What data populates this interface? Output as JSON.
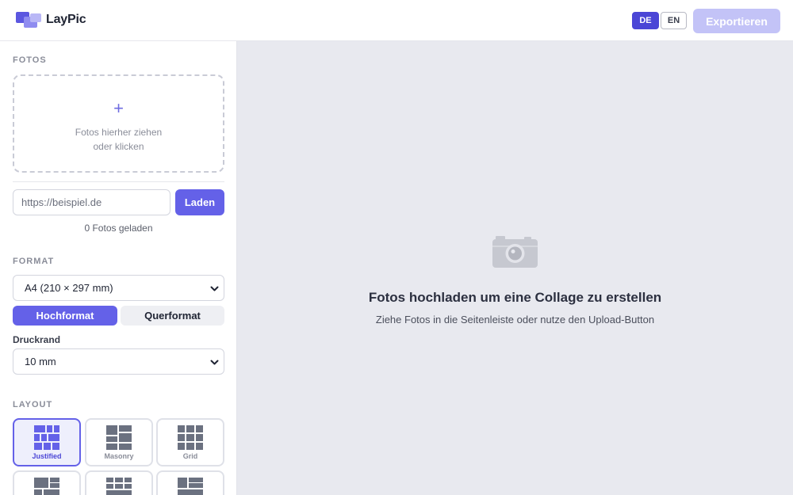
{
  "app": {
    "name": "LayPic",
    "brand_color": "#6461e8"
  },
  "header": {
    "languages": [
      {
        "label": "DE",
        "active": true
      },
      {
        "label": "EN",
        "active": false
      }
    ],
    "export_label": "Exportieren"
  },
  "sidebar": {
    "photos": {
      "title": "FOTOS",
      "dropzone_text": "Fotos hierher ziehen oder klicken",
      "url_placeholder": "https://beispiel.de",
      "load_label": "Laden",
      "count_text": "0 Fotos geladen"
    },
    "format": {
      "title": "FORMAT",
      "page_size": "A4 (210 × 297 mm)",
      "orientations": [
        {
          "label": "Hochformat",
          "active": true
        },
        {
          "label": "Querformat",
          "active": false
        }
      ],
      "margin_label": "Druckrand",
      "margin_value": "10 mm"
    },
    "layout": {
      "title": "LAYOUT",
      "options": [
        {
          "label": "Justified",
          "icon": "justified-layout-icon",
          "active": true
        },
        {
          "label": "Masonry",
          "icon": "masonry-layout-icon",
          "active": false
        },
        {
          "label": "Grid",
          "icon": "grid-layout-icon",
          "active": false
        }
      ]
    }
  },
  "main": {
    "empty_icon": "camera-icon",
    "empty_title": "Fotos hochladen um eine Collage zu erstellen",
    "empty_subtitle": "Ziehe Fotos in die Seitenleiste oder nutze den Upload-Button"
  }
}
